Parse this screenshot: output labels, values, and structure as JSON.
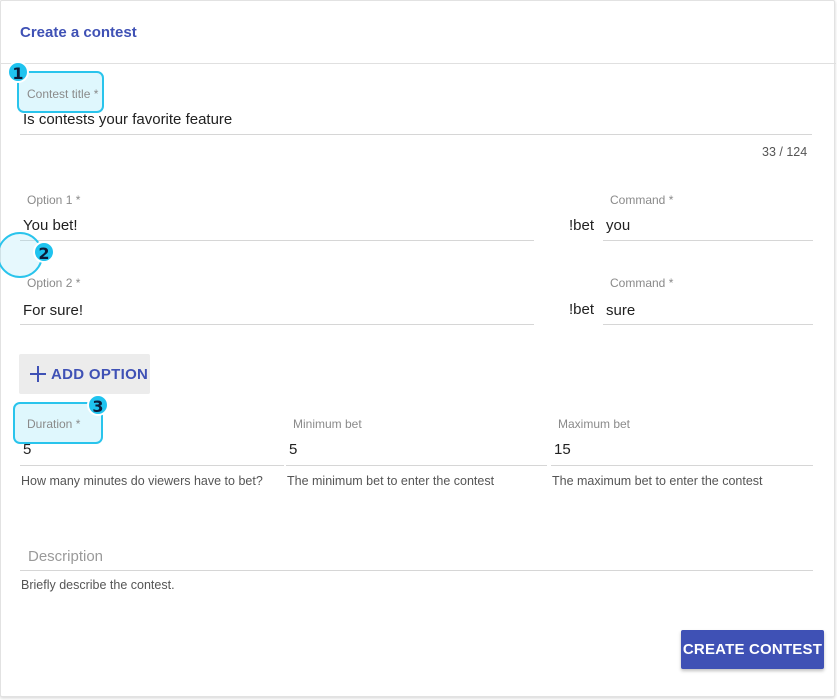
{
  "header": {
    "title": "Create a contest"
  },
  "contest_title": {
    "label": "Contest title *",
    "value": "Is contests your favorite feature",
    "counter": "33 / 124"
  },
  "options": [
    {
      "label": "Option 1 *",
      "value": "You bet!",
      "command_label": "Command *",
      "command_prefix": "!bet",
      "command_value": "you"
    },
    {
      "label": "Option 2 *",
      "value": "For sure!",
      "command_label": "Command *",
      "command_prefix": "!bet",
      "command_value": "sure"
    }
  ],
  "add_option_label": "ADD OPTION",
  "duration": {
    "label": "Duration *",
    "value": "5",
    "hint": "How many minutes do viewers have to bet?"
  },
  "min_bet": {
    "label": "Minimum bet",
    "value": "5",
    "hint": "The minimum bet to enter the contest"
  },
  "max_bet": {
    "label": "Maximum bet",
    "value": "15",
    "hint": "The maximum bet to enter the contest"
  },
  "description": {
    "placeholder": "Description",
    "hint": "Briefly describe the contest."
  },
  "create_button": "CREATE CONTEST",
  "annotations": {
    "badge1": "1",
    "badge2": "2",
    "badge3": "3"
  },
  "colors": {
    "primary": "#3f51b5",
    "highlight": "#29c4ec"
  }
}
